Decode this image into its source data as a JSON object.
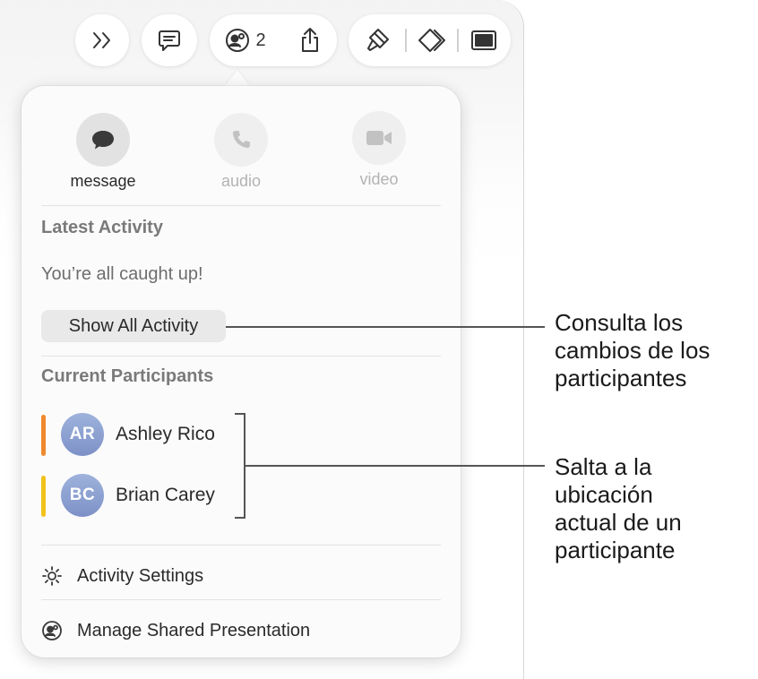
{
  "toolbar": {
    "collaboration_count": "2",
    "icons": [
      "chevrons-right-icon",
      "comment-icon",
      "collaboration-icon",
      "share-icon",
      "format-brush-icon",
      "animate-icon",
      "document-icon"
    ]
  },
  "popover": {
    "communication": [
      {
        "label": "message",
        "icon": "message-bubble-icon",
        "enabled": true
      },
      {
        "label": "audio",
        "icon": "phone-icon",
        "enabled": false
      },
      {
        "label": "video",
        "icon": "video-camera-icon",
        "enabled": false
      }
    ],
    "latest_activity": {
      "title": "Latest Activity",
      "status": "You’re all caught up!",
      "button_label": "Show All Activity"
    },
    "participants": {
      "title": "Current Participants",
      "items": [
        {
          "initials": "AR",
          "name": "Ashley Rico",
          "color": "#f0892d"
        },
        {
          "initials": "BC",
          "name": "Brian Carey",
          "color": "#f2c21b"
        }
      ]
    },
    "menu": {
      "activity_settings": "Activity Settings",
      "manage_shared": "Manage Shared Presentation"
    }
  },
  "callouts": {
    "activity_lines": [
      "Consulta los",
      "cambios de los",
      "participantes"
    ],
    "participant_lines": [
      "Salta a la",
      "ubicación",
      "actual de un",
      "participante"
    ]
  }
}
